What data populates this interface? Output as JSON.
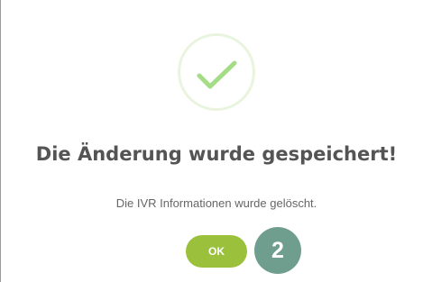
{
  "dialog": {
    "icon": "checkmark-icon",
    "title": "Die Änderung wurde gespeichert!",
    "message": "Die IVR Informationen wurde gelöscht.",
    "ok_label": "OK"
  },
  "step_badge": {
    "number": "2"
  },
  "colors": {
    "success_icon_ring": "#e9f4df",
    "checkmark": "#a5dc86",
    "ok_button": "#9bc13c",
    "step_badge": "#6f9e8f",
    "title_text": "#545454"
  }
}
